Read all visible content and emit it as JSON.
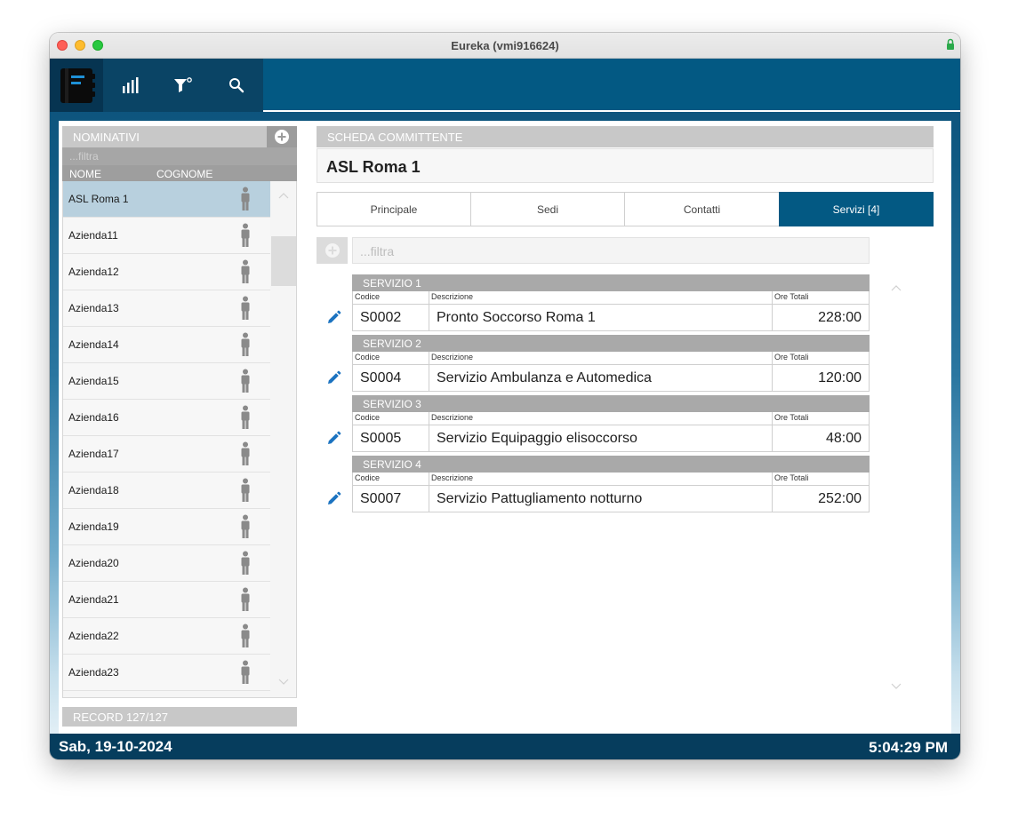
{
  "window": {
    "title": "Eureka (vmi916624)"
  },
  "left": {
    "header": "NOMINATIVI",
    "filter_placeholder": "...filtra",
    "columns": [
      "NOME",
      "COGNOME"
    ],
    "rows": [
      "ASL Roma 1",
      "Azienda11",
      "Azienda12",
      "Azienda13",
      "Azienda14",
      "Azienda15",
      "Azienda16",
      "Azienda17",
      "Azienda18",
      "Azienda19",
      "Azienda20",
      "Azienda21",
      "Azienda22",
      "Azienda23"
    ],
    "selected_index": 0,
    "record": "RECORD 127/127"
  },
  "scheda": {
    "header": "SCHEDA COMMITTENTE",
    "title": "ASL Roma 1",
    "tabs": [
      "Principale",
      "Sedi",
      "Contatti",
      "Servizi [4]"
    ],
    "active_tab": 3,
    "filter_placeholder": "...filtra",
    "field_labels": {
      "code": "Codice",
      "desc": "Descrizione",
      "hours": "Ore Totali"
    },
    "services": [
      {
        "header": "SERVIZIO 1",
        "code": "S0002",
        "desc": "Pronto Soccorso Roma 1",
        "hours": "228:00"
      },
      {
        "header": "SERVIZIO 2",
        "code": "S0004",
        "desc": "Servizio Ambulanza e Automedica",
        "hours": "120:00"
      },
      {
        "header": "SERVIZIO 3",
        "code": "S0005",
        "desc": "Servizio Equipaggio elisoccorso",
        "hours": "48:00"
      },
      {
        "header": "SERVIZIO 4",
        "code": "S0007",
        "desc": "Servizio Pattugliamento notturno",
        "hours": "252:00"
      }
    ]
  },
  "status": {
    "date": "Sab, 19-10-2024",
    "time": "5:04:29 PM"
  },
  "colors": {
    "accent": "#035983",
    "selected_row": "#b8d0de",
    "header_gray": "#c8c8c8",
    "pencil": "#1b73c0"
  }
}
